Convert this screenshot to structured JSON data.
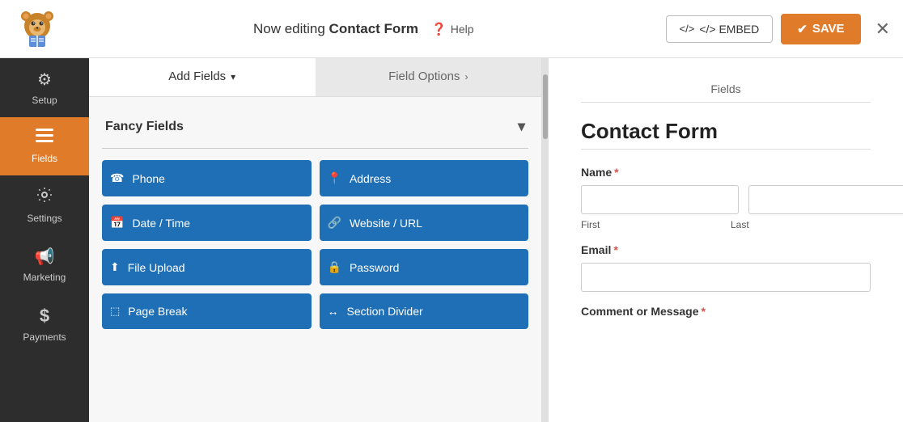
{
  "topbar": {
    "editing_prefix": "Now editing ",
    "form_name": "Contact Form",
    "help_label": "Help",
    "embed_label": "</>  EMBED",
    "save_label": "✔ SAVE",
    "close_label": "✕"
  },
  "sidebar": {
    "items": [
      {
        "id": "setup",
        "label": "Setup",
        "icon": "⚙"
      },
      {
        "id": "fields",
        "label": "Fields",
        "icon": "☰",
        "active": true
      },
      {
        "id": "settings",
        "label": "Settings",
        "icon": "⊞"
      },
      {
        "id": "marketing",
        "label": "Marketing",
        "icon": "📢"
      },
      {
        "id": "payments",
        "label": "Payments",
        "icon": "$"
      }
    ]
  },
  "fields_panel": {
    "tabs": [
      {
        "id": "add-fields",
        "label": "Add Fields",
        "active": true
      },
      {
        "id": "field-options",
        "label": "Field Options",
        "active": false
      }
    ],
    "section_label": "Fancy Fields",
    "field_buttons": [
      {
        "id": "phone",
        "label": "Phone",
        "icon": "📞"
      },
      {
        "id": "address",
        "label": "Address",
        "icon": "📍"
      },
      {
        "id": "datetime",
        "label": "Date / Time",
        "icon": "📅"
      },
      {
        "id": "website",
        "label": "Website / URL",
        "icon": "🔗"
      },
      {
        "id": "fileupload",
        "label": "File Upload",
        "icon": "⬆"
      },
      {
        "id": "password",
        "label": "Password",
        "icon": "🔒"
      },
      {
        "id": "pagebreak",
        "label": "Page Break",
        "icon": "⬚"
      },
      {
        "id": "sectiondivider",
        "label": "Section Divider",
        "icon": "↔"
      }
    ]
  },
  "form_preview": {
    "tab_label": "Fields",
    "form_title": "Contact Form",
    "fields": [
      {
        "id": "name",
        "label": "Name",
        "required": true,
        "type": "name",
        "sub_labels": [
          "First",
          "Last"
        ]
      },
      {
        "id": "email",
        "label": "Email",
        "required": true,
        "type": "email"
      },
      {
        "id": "comment",
        "label": "Comment or Message",
        "required": true,
        "type": "textarea"
      }
    ]
  }
}
